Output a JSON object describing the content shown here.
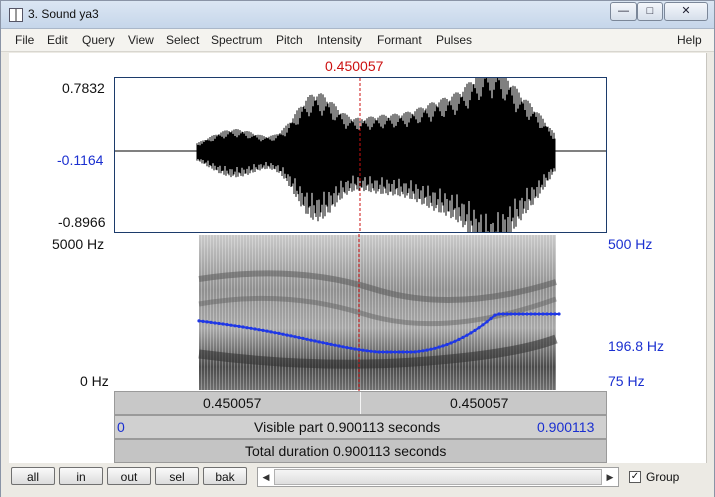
{
  "window": {
    "title": "3. Sound ya3"
  },
  "menu": [
    "File",
    "Edit",
    "Query",
    "View",
    "Select",
    "Spectrum",
    "Pitch",
    "Intensity",
    "Formant",
    "Pulses"
  ],
  "help": "Help",
  "cursor_time": "0.450057",
  "waveform": {
    "max": "0.7832",
    "cursor_value": "-0.1164",
    "min": "-0.8966"
  },
  "spectrogram": {
    "freq_max": "5000 Hz",
    "freq_min": "0 Hz",
    "pitch_max": "500 Hz",
    "pitch_value": "196.8 Hz",
    "pitch_min": "75 Hz"
  },
  "time_bar": {
    "left": "0.450057",
    "right": "0.450057"
  },
  "visible_bar": {
    "start": "0",
    "label": "Visible part 0.900113 seconds",
    "end": "0.900113"
  },
  "total_bar": {
    "label": "Total duration 0.900113 seconds"
  },
  "buttons": [
    "all",
    "in",
    "out",
    "sel",
    "bak"
  ],
  "group": {
    "label": "Group",
    "checked": true
  },
  "colors": {
    "cursor": "#cc1111",
    "blue": "#1a2fd0",
    "pitch": "#1f37e6"
  }
}
